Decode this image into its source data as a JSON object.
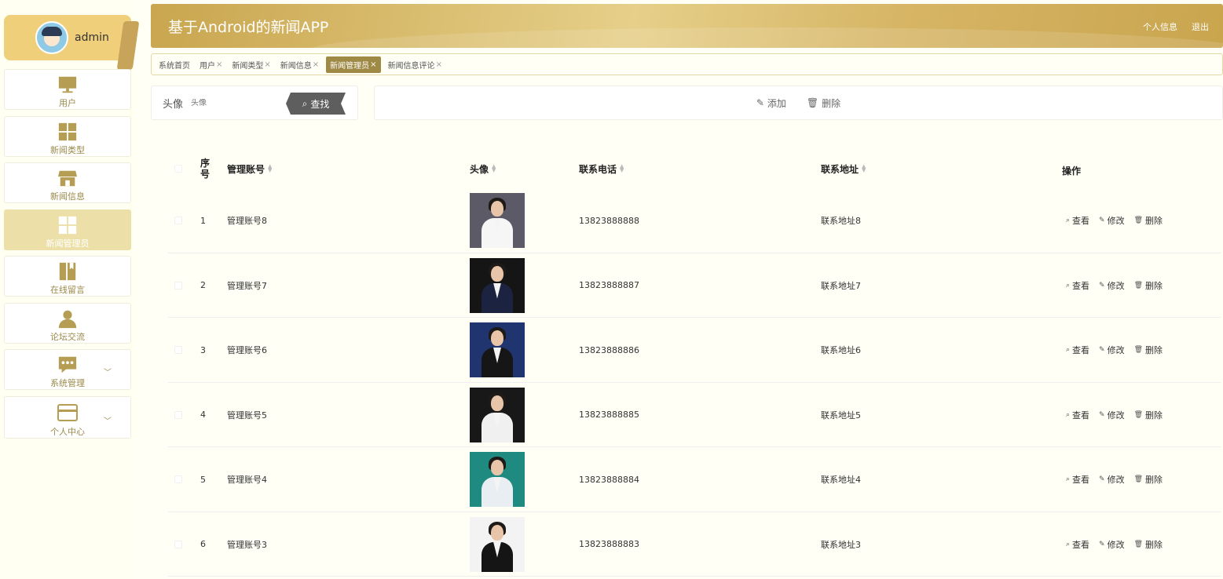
{
  "user": {
    "name": "admin"
  },
  "sidebar": {
    "items": [
      {
        "label": "用户",
        "icon": "monitor-icon"
      },
      {
        "label": "新闻类型",
        "icon": "grid-icon"
      },
      {
        "label": "新闻信息",
        "icon": "shop-icon"
      },
      {
        "label": "新闻管理员",
        "icon": "grid-icon"
      },
      {
        "label": "在线留言",
        "icon": "book-icon"
      },
      {
        "label": "论坛交流",
        "icon": "person-icon"
      },
      {
        "label": "系统管理",
        "icon": "chat-icon"
      },
      {
        "label": "个人中心",
        "icon": "card-icon"
      }
    ]
  },
  "header": {
    "title": "基于Android的新闻APP",
    "profile_link": "个人信息",
    "logout_link": "退出"
  },
  "tabs": [
    "系统首页",
    "用户",
    "新闻类型",
    "新闻信息",
    "新闻管理员",
    "新闻信息评论"
  ],
  "search": {
    "label": "头像",
    "placeholder": "头像",
    "button": "查找"
  },
  "actions": {
    "add": "添加",
    "delete": "删除"
  },
  "table": {
    "headers": {
      "index": "序号",
      "account": "管理账号",
      "avatar": "头像",
      "phone": "联系电话",
      "address": "联系地址",
      "ops": "操作"
    },
    "row_ops": {
      "view": "查看",
      "edit": "修改",
      "delete": "删除"
    },
    "rows": [
      {
        "index": "1",
        "account": "管理账号8",
        "phone": "13823888888",
        "address": "联系地址8"
      },
      {
        "index": "2",
        "account": "管理账号7",
        "phone": "13823888887",
        "address": "联系地址7"
      },
      {
        "index": "3",
        "account": "管理账号6",
        "phone": "13823888886",
        "address": "联系地址6"
      },
      {
        "index": "4",
        "account": "管理账号5",
        "phone": "13823888885",
        "address": "联系地址5"
      },
      {
        "index": "5",
        "account": "管理账号4",
        "phone": "13823888884",
        "address": "联系地址4"
      },
      {
        "index": "6",
        "account": "管理账号3",
        "phone": "13823888883",
        "address": "联系地址3"
      }
    ]
  },
  "colors": {
    "accent": "#c9a64f",
    "active_menu": "#ece0a8",
    "active_tab": "#9f8a45",
    "search_button": "#5e5e5e"
  }
}
